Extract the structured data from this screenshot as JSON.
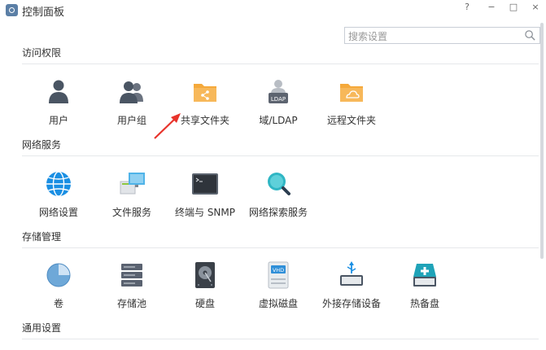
{
  "window": {
    "title": "控制面板",
    "help": "?",
    "minimize": "−",
    "maximize": "□",
    "close": "×"
  },
  "search": {
    "placeholder": "搜索设置",
    "value": ""
  },
  "sections": {
    "access": {
      "title": "访问权限",
      "items": [
        {
          "label": "用户",
          "icon": "user-icon"
        },
        {
          "label": "用户组",
          "icon": "user-group-icon"
        },
        {
          "label": "共享文件夹",
          "icon": "shared-folder-icon"
        },
        {
          "label": "域/LDAP",
          "icon": "ldap-icon"
        },
        {
          "label": "远程文件夹",
          "icon": "remote-folder-icon"
        }
      ]
    },
    "network": {
      "title": "网络服务",
      "items": [
        {
          "label": "网络设置",
          "icon": "globe-icon"
        },
        {
          "label": "文件服务",
          "icon": "file-service-icon"
        },
        {
          "label": "终端与 SNMP",
          "icon": "terminal-icon"
        },
        {
          "label": "网络探索服务",
          "icon": "discovery-icon"
        }
      ]
    },
    "storage": {
      "title": "存储管理",
      "items": [
        {
          "label": "卷",
          "icon": "volume-icon"
        },
        {
          "label": "存储池",
          "icon": "storage-pool-icon"
        },
        {
          "label": "硬盘",
          "icon": "hard-disk-icon"
        },
        {
          "label": "虚拟磁盘",
          "icon": "virtual-disk-icon"
        },
        {
          "label": "外接存储设备",
          "icon": "usb-storage-icon"
        },
        {
          "label": "热备盘",
          "icon": "hot-spare-icon"
        }
      ]
    },
    "general": {
      "title": "通用设置"
    }
  },
  "icon_texts": {
    "ldap_badge": "LDAP",
    "vhd_badge": "VHD"
  },
  "colors": {
    "folder_orange": "#f5a93b",
    "globe_blue": "#1a8fe3",
    "user_gray": "#4a5563",
    "teal": "#1fa3b8",
    "annotation_arrow": "#e8332b"
  }
}
